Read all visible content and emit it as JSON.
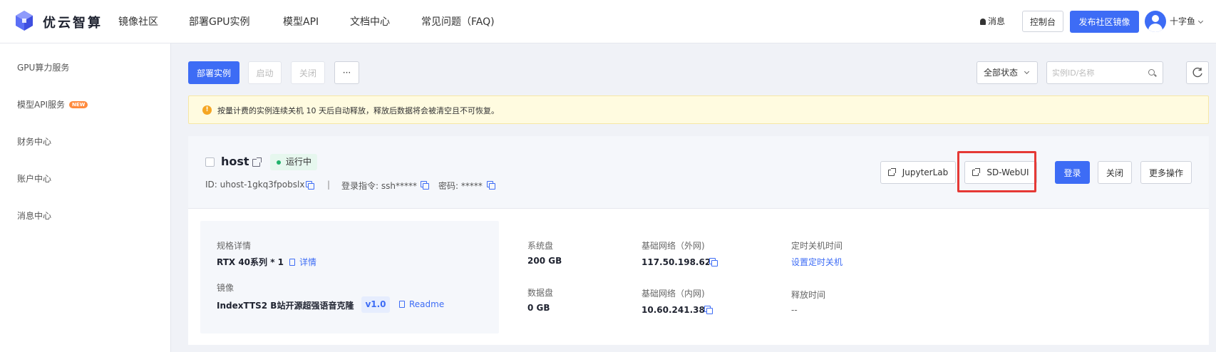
{
  "brand": {
    "name": "优云智算",
    "accent": "#3d6cf5"
  },
  "nav": {
    "items": [
      "镜像社区",
      "部署GPU实例",
      "模型API",
      "文档中心",
      "常见问题（FAQ)"
    ],
    "messages": "消息",
    "console": "控制台",
    "publish": "发布社区镜像",
    "user": "十字鱼"
  },
  "sidebar": {
    "items": [
      "GPU算力服务",
      "模型API服务",
      "财务中心",
      "账户中心",
      "消息中心"
    ],
    "new_badge": "NEW"
  },
  "toolbar": {
    "deploy": "部署实例",
    "start": "启动",
    "stop": "关闭",
    "more": "···",
    "status_filter": "全部状态",
    "search_placeholder": "实例ID/名称"
  },
  "notice": "按量计费的实例连续关机 10 天后自动释放，释放后数据将会被清空且不可恢复。",
  "instance": {
    "name": "host",
    "status": "运行中",
    "id": "ID: uhost-1gkq3fpobslx",
    "separator": "|",
    "login_cmd": "登录指令: ssh*****",
    "password": "密码: *****",
    "buttons": {
      "jupyter": "JupyterLab",
      "sdwebui": "SD-WebUI",
      "login": "登录",
      "close": "关闭",
      "more": "更多操作"
    },
    "spec_label": "规格详情",
    "spec_value": "RTX 40系列 * 1",
    "detail_link": "详情",
    "image_label": "镜像",
    "image_value": "IndexTTS2 B站开源超强语音克隆",
    "image_version": "v1.0",
    "readme": "Readme",
    "system_disk_label": "系统盘",
    "system_disk_value": "200 GB",
    "data_disk_label": "数据盘",
    "data_disk_value": "0 GB",
    "public_net_label": "基础网络（外网)",
    "public_ip": "117.50.198.62",
    "private_net_label": "基础网络（内网)",
    "private_ip": "10.60.241.38",
    "shutdown_label": "定时关机时间",
    "shutdown_link": "设置定时关机",
    "release_label": "释放时间",
    "release_value": "--"
  }
}
